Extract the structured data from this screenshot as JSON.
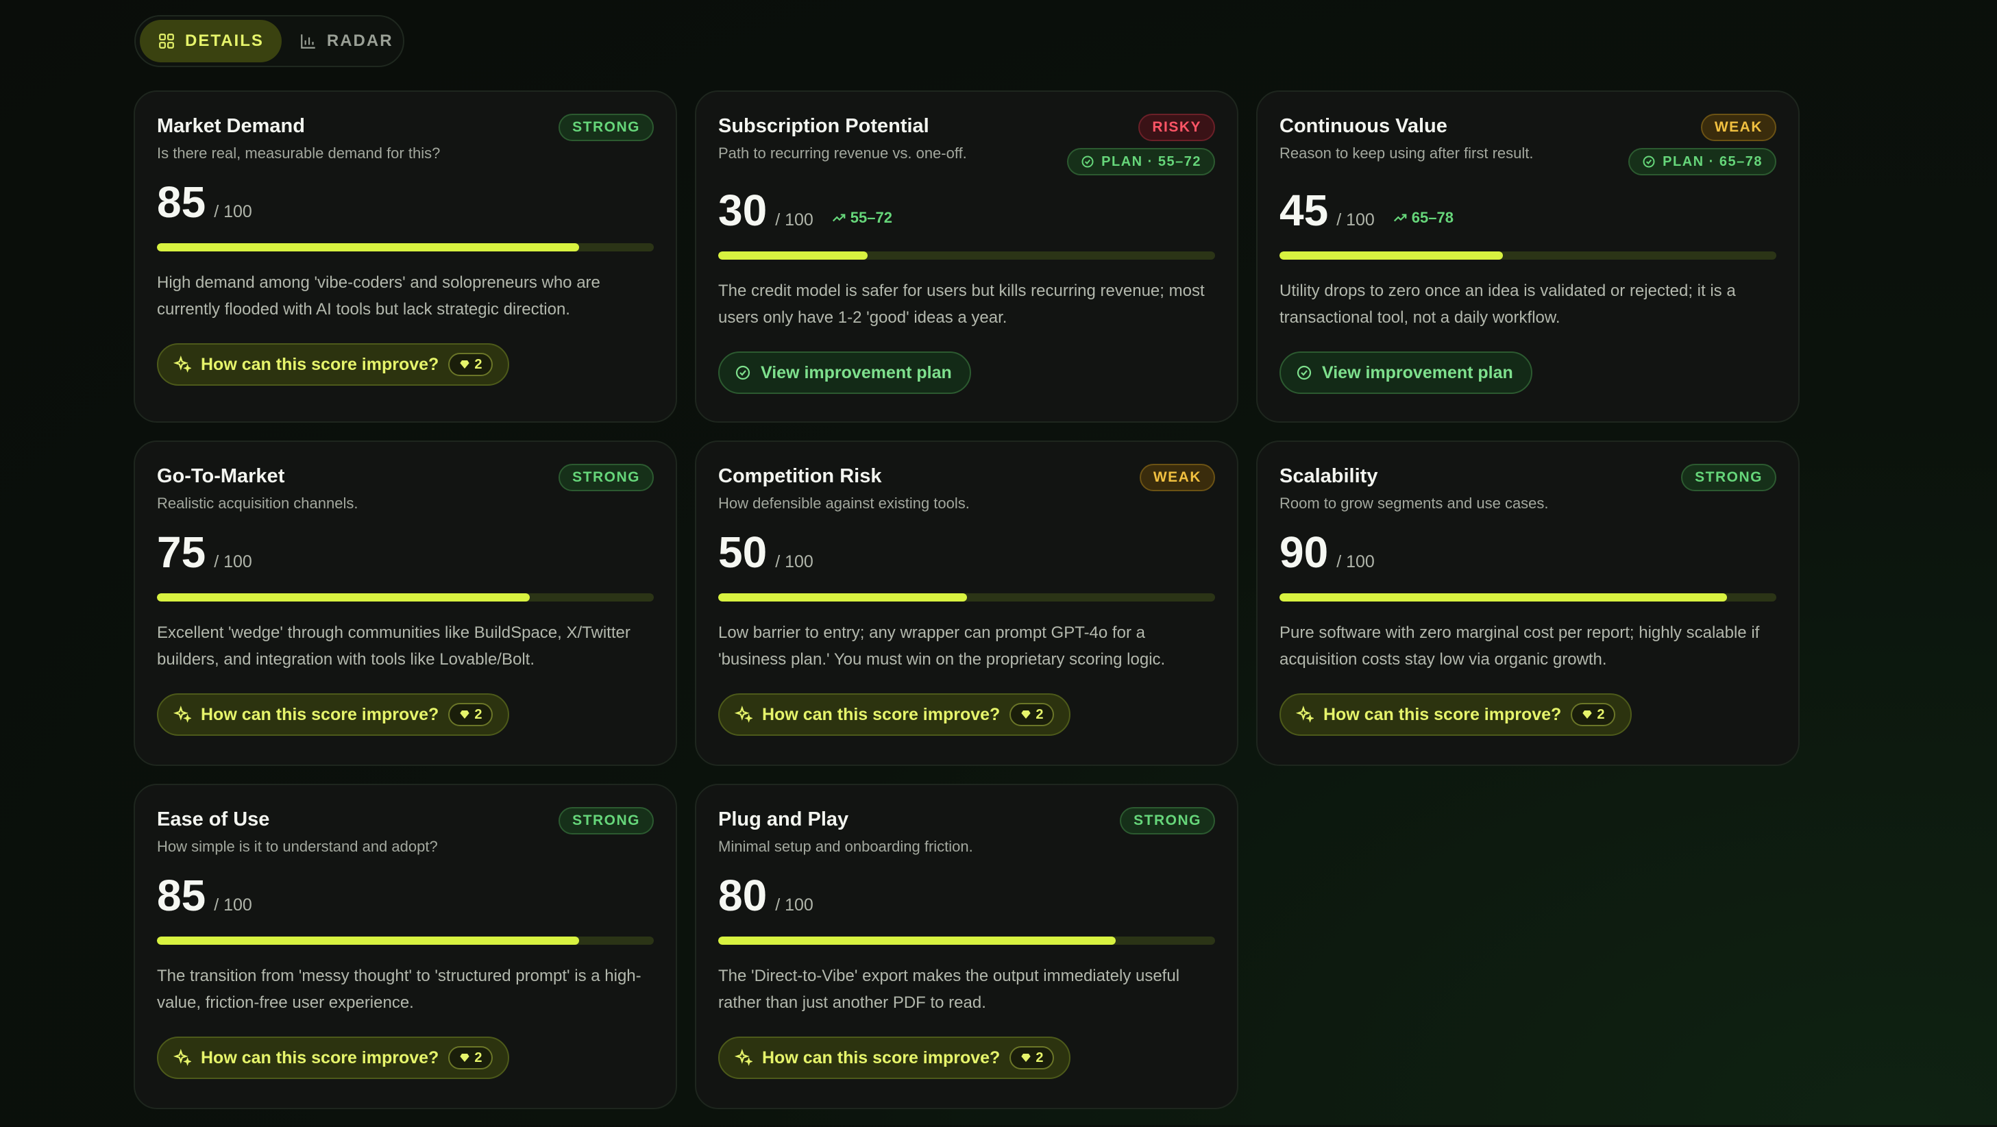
{
  "toggle": {
    "details_label": "DETAILS",
    "radar_label": "RADAR"
  },
  "colors": {
    "accent": "#d8f240",
    "strong": "#66d67a",
    "risky": "#ff5566",
    "weak": "#f1c040",
    "background": "#0b120c"
  },
  "cards": [
    {
      "title": "Market Demand",
      "subtitle": "Is there real, measurable demand for this?",
      "badge": "STRONG",
      "score": "85",
      "max": "/ 100",
      "progress_percent": 85,
      "description": "High demand among 'vibe-coders' and solopreneurs who are currently flooded with AI tools but lack strategic direction.",
      "action": "How can this score improve?",
      "count": "2"
    },
    {
      "title": "Subscription Potential",
      "subtitle": "Path to recurring revenue vs. one-off.",
      "badge": "RISKY",
      "plan": "PLAN · 55–72",
      "score": "30",
      "max": "/ 100",
      "range": "55–72",
      "progress_percent": 30,
      "description": "The credit model is safer for users but kills recurring revenue; most users only have 1-2 'good' ideas a year.",
      "action": "View improvement plan"
    },
    {
      "title": "Continuous Value",
      "subtitle": "Reason to keep using after first result.",
      "badge": "WEAK",
      "plan": "PLAN · 65–78",
      "score": "45",
      "max": "/ 100",
      "range": "65–78",
      "progress_percent": 45,
      "description": "Utility drops to zero once an idea is validated or rejected; it is a transactional tool, not a daily workflow.",
      "action": "View improvement plan"
    },
    {
      "title": "Go-To-Market",
      "subtitle": "Realistic acquisition channels.",
      "badge": "STRONG",
      "score": "75",
      "max": "/ 100",
      "progress_percent": 75,
      "description": "Excellent 'wedge' through communities like BuildSpace, X/Twitter builders, and integration with tools like Lovable/Bolt.",
      "action": "How can this score improve?",
      "count": "2"
    },
    {
      "title": "Competition Risk",
      "subtitle": "How defensible against existing tools.",
      "badge": "WEAK",
      "score": "50",
      "max": "/ 100",
      "progress_percent": 50,
      "description": "Low barrier to entry; any wrapper can prompt GPT-4o for a 'business plan.' You must win on the proprietary scoring logic.",
      "action": "How can this score improve?",
      "count": "2"
    },
    {
      "title": "Scalability",
      "subtitle": "Room to grow segments and use cases.",
      "badge": "STRONG",
      "score": "90",
      "max": "/ 100",
      "progress_percent": 90,
      "description": "Pure software with zero marginal cost per report; highly scalable if acquisition costs stay low via organic growth.",
      "action": "How can this score improve?",
      "count": "2"
    },
    {
      "title": "Ease of Use",
      "subtitle": "How simple is it to understand and adopt?",
      "badge": "STRONG",
      "score": "85",
      "max": "/ 100",
      "progress_percent": 85,
      "description": "The transition from 'messy thought' to 'structured prompt' is a high-value, friction-free user experience.",
      "action": "How can this score improve?",
      "count": "2"
    },
    {
      "title": "Plug and Play",
      "subtitle": "Minimal setup and onboarding friction.",
      "badge": "STRONG",
      "score": "80",
      "max": "/ 100",
      "progress_percent": 80,
      "description": "The 'Direct-to-Vibe' export makes the output immediately useful rather than just another PDF to read.",
      "action": "How can this score improve?",
      "count": "2"
    }
  ]
}
